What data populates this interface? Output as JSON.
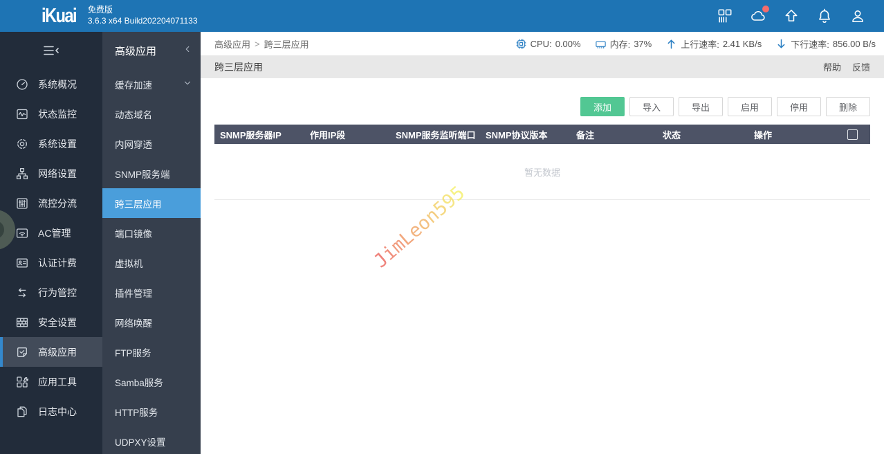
{
  "topbar": {
    "logo": "iKuai",
    "edition": "免费版",
    "build": "3.6.3 x64 Build202204071133",
    "icons": [
      {
        "name": "apps-grid-icon",
        "badge": false
      },
      {
        "name": "cloud-icon",
        "badge": true
      },
      {
        "name": "upload-arrow-icon",
        "badge": false
      },
      {
        "name": "bell-icon",
        "badge": false
      },
      {
        "name": "user-icon",
        "badge": false
      }
    ]
  },
  "sidebar": {
    "items": [
      {
        "label": "系统概况",
        "icon": "gauge-icon",
        "active": false
      },
      {
        "label": "状态监控",
        "icon": "monitor-icon",
        "active": false
      },
      {
        "label": "系统设置",
        "icon": "gear-icon",
        "active": false
      },
      {
        "label": "网络设置",
        "icon": "network-icon",
        "active": false
      },
      {
        "label": "流控分流",
        "icon": "sliders-icon",
        "active": false
      },
      {
        "label": "AC管理",
        "icon": "wifi-icon",
        "active": false
      },
      {
        "label": "认证计费",
        "icon": "idcard-icon",
        "active": false
      },
      {
        "label": "行为管控",
        "icon": "arrows-icon",
        "active": false
      },
      {
        "label": "安全设置",
        "icon": "firewall-icon",
        "active": false
      },
      {
        "label": "高级应用",
        "icon": "advanced-icon",
        "active": true
      },
      {
        "label": "应用工具",
        "icon": "tools-icon",
        "active": false
      },
      {
        "label": "日志中心",
        "icon": "logs-icon",
        "active": false
      }
    ]
  },
  "submenu": {
    "title": "高级应用",
    "items": [
      {
        "label": "缓存加速",
        "expandable": true,
        "active": false
      },
      {
        "label": "动态域名",
        "expandable": false,
        "active": false
      },
      {
        "label": "内网穿透",
        "expandable": false,
        "active": false
      },
      {
        "label": "SNMP服务端",
        "expandable": false,
        "active": false
      },
      {
        "label": "跨三层应用",
        "expandable": false,
        "active": true
      },
      {
        "label": "端口镜像",
        "expandable": false,
        "active": false
      },
      {
        "label": "虚拟机",
        "expandable": false,
        "active": false
      },
      {
        "label": "插件管理",
        "expandable": false,
        "active": false
      },
      {
        "label": "网络唤醒",
        "expandable": false,
        "active": false
      },
      {
        "label": "FTP服务",
        "expandable": false,
        "active": false
      },
      {
        "label": "Samba服务",
        "expandable": false,
        "active": false
      },
      {
        "label": "HTTP服务",
        "expandable": false,
        "active": false
      },
      {
        "label": "UDPXY设置",
        "expandable": false,
        "active": false
      }
    ]
  },
  "breadcrumb": {
    "parent": "高级应用",
    "separator": ">",
    "current": "跨三层应用"
  },
  "stats": [
    {
      "icon": "cpu-icon",
      "label": "CPU:",
      "value": "0.00%"
    },
    {
      "icon": "memory-icon",
      "label": "内存:",
      "value": "37%"
    },
    {
      "icon": "arrow-up-icon",
      "label": "上行速率:",
      "value": "2.41 KB/s"
    },
    {
      "icon": "arrow-down-icon",
      "label": "下行速率:",
      "value": "856.00 B/s"
    }
  ],
  "page": {
    "title": "跨三层应用",
    "help": "帮助",
    "feedback": "反馈"
  },
  "toolbar": [
    {
      "label": "添加",
      "primary": true
    },
    {
      "label": "导入",
      "primary": false
    },
    {
      "label": "导出",
      "primary": false
    },
    {
      "label": "启用",
      "primary": false
    },
    {
      "label": "停用",
      "primary": false
    },
    {
      "label": "删除",
      "primary": false
    }
  ],
  "table": {
    "columns": [
      "SNMP服务器IP",
      "作用IP段",
      "SNMP服务监听端口",
      "SNMP协议版本",
      "备注",
      "状态",
      "操作"
    ],
    "empty_text": "暂无数据"
  },
  "watermark": {
    "text": "JimLeon595",
    "color_start": "#ec655c",
    "color_end": "#f5ef68"
  },
  "colors": {
    "topbar": "#1e74b4",
    "sidebar": "#222c3a",
    "submenu_bg": "#363f4d",
    "submenu_active": "#4a9edb",
    "table_header": "#4d5366",
    "primary_button": "#52c793",
    "accent_blue": "#2a7fc3",
    "badge": "#f56c6c"
  }
}
